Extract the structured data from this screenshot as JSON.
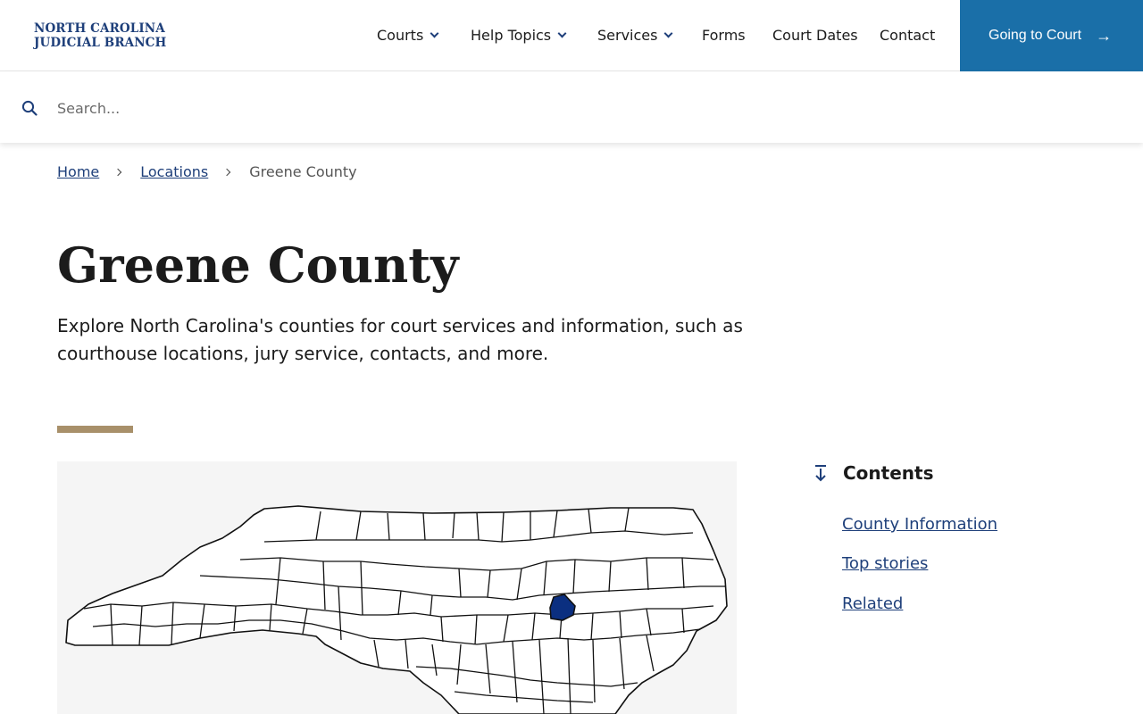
{
  "header": {
    "logo_line1": "NORTH CAROLINA",
    "logo_line2": "JUDICIAL BRANCH",
    "nav": [
      {
        "label": "Courts"
      },
      {
        "label": "Help Topics"
      },
      {
        "label": "Services"
      },
      {
        "label": "Forms"
      },
      {
        "label": "Court Dates"
      },
      {
        "label": "Contact"
      }
    ],
    "cta_label": "Going to Court",
    "cta_icon": "arrow-right-icon"
  },
  "search": {
    "placeholder": "Search...",
    "value": ""
  },
  "breadcrumb": {
    "items": [
      {
        "label": "Home"
      },
      {
        "label": "Locations"
      }
    ],
    "current": "Greene County"
  },
  "main": {
    "title": "Greene County",
    "intro": "Explore North Carolina's counties for court services and information, such as courthouse locations, jury service, contacts, and more."
  },
  "map": {
    "highlighted_county": "Greene County",
    "highlight_color": "#0b2f80"
  },
  "contents": {
    "heading": "Contents",
    "items": [
      {
        "label": "County Information"
      },
      {
        "label": "Top stories"
      },
      {
        "label": "Related"
      }
    ]
  },
  "colors": {
    "brand": "#1e3f7a",
    "cta": "#1a6fa8",
    "accent": "#a8906a"
  }
}
